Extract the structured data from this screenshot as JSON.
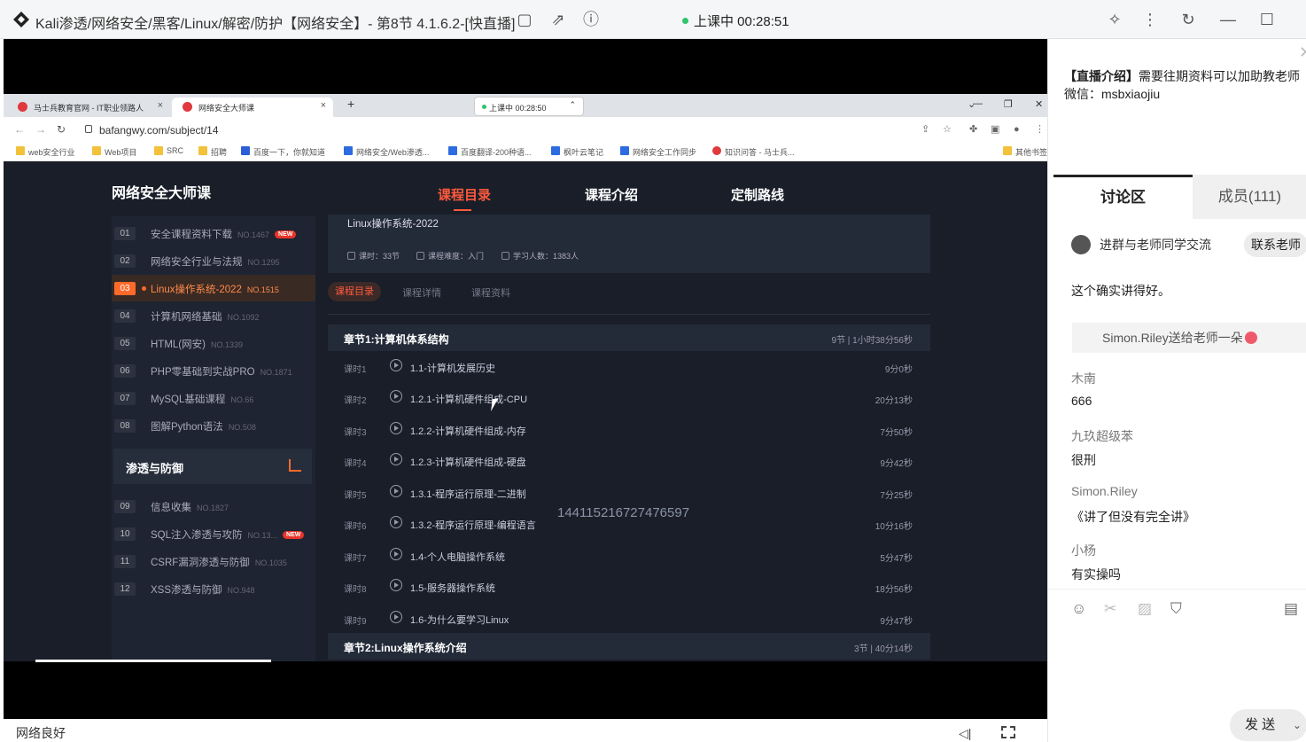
{
  "window": {
    "title": "Kali渗透/网络安全/黑客/Linux/解密/防护【网络安全】- 第8节 4.1.6.2-[快直播]",
    "live_status": "上课中 00:28:51"
  },
  "browser": {
    "tabs": [
      {
        "label": "马士兵教育官网 - IT职业领路人",
        "close": "×"
      },
      {
        "label": "网络安全大师课",
        "close": "×"
      }
    ],
    "new_tab": "+",
    "mini_live": "上课中 00:28:50",
    "url": "bafangwy.com/subject/14",
    "bookmarks": [
      "web安全行业",
      "Web项目",
      "SRC",
      "招聘",
      "百度一下，你就知道",
      "网络安全/Web渗透...",
      "百度翻译-200种语...",
      "枫叶云笔记",
      "网络安全工作同步",
      "知识问答 - 马士兵...",
      "其他书签"
    ]
  },
  "site": {
    "brand": "网络安全大师课",
    "nav": [
      "课程目录",
      "课程介绍",
      "定制路线"
    ],
    "sidebar": [
      {
        "num": "01",
        "label": "安全课程资料下载",
        "no": "NO.1467",
        "badge": "NEW"
      },
      {
        "num": "02",
        "label": "网络安全行业与法规",
        "no": "NO.1295",
        "badge": ""
      },
      {
        "num": "03",
        "label": "Linux操作系统-2022",
        "no": "NO.1515",
        "badge": ""
      },
      {
        "num": "04",
        "label": "计算机网络基础",
        "no": "NO.1092",
        "badge": ""
      },
      {
        "num": "05",
        "label": "HTML(网安)",
        "no": "NO.1339",
        "badge": ""
      },
      {
        "num": "06",
        "label": "PHP零基础到实战PRO",
        "no": "NO.1871",
        "badge": ""
      },
      {
        "num": "07",
        "label": "MySQL基础课程",
        "no": "NO.66",
        "badge": ""
      },
      {
        "num": "08",
        "label": "图解Python语法",
        "no": "NO.508",
        "badge": ""
      }
    ],
    "section2_title": "渗透与防御",
    "sidebar2": [
      {
        "num": "09",
        "label": "信息收集",
        "no": "NO.1827",
        "badge": ""
      },
      {
        "num": "10",
        "label": "SQL注入渗透与攻防",
        "no": "NO.13...",
        "badge": "NEW"
      },
      {
        "num": "11",
        "label": "CSRF漏洞渗透与防御",
        "no": "NO.1035",
        "badge": ""
      },
      {
        "num": "12",
        "label": "XSS渗透与防御",
        "no": "NO.948",
        "badge": ""
      }
    ],
    "course": {
      "title": "Linux操作系统-2022",
      "meta": [
        "课时：33节",
        "课程难度：入门",
        "学习人数：1383人"
      ],
      "tabs": [
        "课程目录",
        "课程详情",
        "课程资料"
      ]
    },
    "chapter1": {
      "title": "章节1:计算机体系结构",
      "info": "9节 | 1小时38分56秒"
    },
    "lessons": [
      {
        "no": "课时1",
        "title": "1.1-计算机发展历史",
        "dur": "9分0秒"
      },
      {
        "no": "课时2",
        "title": "1.2.1-计算机硬件组成-CPU",
        "dur": "20分13秒"
      },
      {
        "no": "课时3",
        "title": "1.2.2-计算机硬件组成-内存",
        "dur": "7分50秒"
      },
      {
        "no": "课时4",
        "title": "1.2.3-计算机硬件组成-硬盘",
        "dur": "9分42秒"
      },
      {
        "no": "课时5",
        "title": "1.3.1-程序运行原理-二进制",
        "dur": "7分25秒"
      },
      {
        "no": "课时6",
        "title": "1.3.2-程序运行原理-编程语言",
        "dur": "10分16秒"
      },
      {
        "no": "课时7",
        "title": "1.4-个人电脑操作系统",
        "dur": "5分47秒"
      },
      {
        "no": "课时8",
        "title": "1.5-服务器操作系统",
        "dur": "18分56秒"
      },
      {
        "no": "课时9",
        "title": "1.6-为什么要学习Linux",
        "dur": "9分47秒"
      }
    ],
    "chapter2": {
      "title": "章节2:Linux操作系统介绍",
      "info": "3节 | 40分14秒"
    },
    "watermark": "144115216727476597"
  },
  "player": {
    "network": "网络良好"
  },
  "side": {
    "intro_tag": "【直播介绍】",
    "intro_text": "需要往期资料可以加助教老师",
    "intro_wechat": "微信：msbxiaojiu",
    "tab_discuss": "讨论区",
    "tab_members": "成员(111)",
    "join_text": "进群与老师同学交流",
    "contact_button": "联系老师",
    "messages": [
      {
        "user": "",
        "text": "这个确实讲得好。"
      },
      {
        "user": "木南",
        "text": "666"
      },
      {
        "user": "九玖超级苯",
        "text": "很刑"
      },
      {
        "user": "Simon.Riley",
        "text": "《讲了但没有完全讲》"
      },
      {
        "user": "小杨",
        "text": "有实操吗"
      }
    ],
    "gift": "Simon.Riley送给老师一朵",
    "send": "发 送"
  }
}
